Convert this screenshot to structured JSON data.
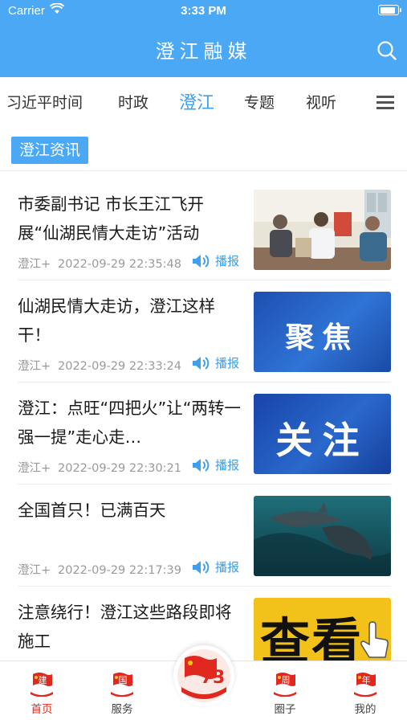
{
  "status": {
    "carrier": "Carrier",
    "time": "3:33 PM"
  },
  "header": {
    "title": "澄江融媒"
  },
  "tabs": [
    {
      "label": "习近平时间"
    },
    {
      "label": "时政"
    },
    {
      "label": "澄江",
      "active": true
    },
    {
      "label": "专题"
    },
    {
      "label": "视听"
    }
  ],
  "section": {
    "label": "澄江资讯"
  },
  "articles": [
    {
      "title": "市委副书记 市长王江飞开展“仙湖民情大走访”活动",
      "source": "澄江+",
      "time": "2022-09-29 22:35:48",
      "action": "播报",
      "thumb": "meeting-photo"
    },
    {
      "title": "仙湖民情大走访，澄江这样干！",
      "source": "澄江+",
      "time": "2022-09-29 22:33:24",
      "action": "播报",
      "thumb": "聚焦"
    },
    {
      "title": "澄江：点旺“四把火”让“两转一强一提”走心走…",
      "source": "澄江+",
      "time": "2022-09-29 22:30:21",
      "action": "播报",
      "thumb": "关注"
    },
    {
      "title": "全国首只！已满百天",
      "source": "澄江+",
      "time": "2022-09-29 22:17:39",
      "action": "播报",
      "thumb": "dolphin-photo"
    },
    {
      "title": "注意绕行！澄江这些路段即将施工",
      "thumb": "查看"
    }
  ],
  "tabbar": [
    {
      "label": "首页",
      "badge": "建",
      "active": true
    },
    {
      "label": "服务",
      "badge": "国"
    },
    {
      "label": "",
      "badge": "73"
    },
    {
      "label": "圈子",
      "badge": "周"
    },
    {
      "label": "我的",
      "badge": "年"
    }
  ],
  "colors": {
    "primary": "#4aa8f4",
    "accent": "#3c9ff0",
    "festive_red": "#e0281f"
  }
}
